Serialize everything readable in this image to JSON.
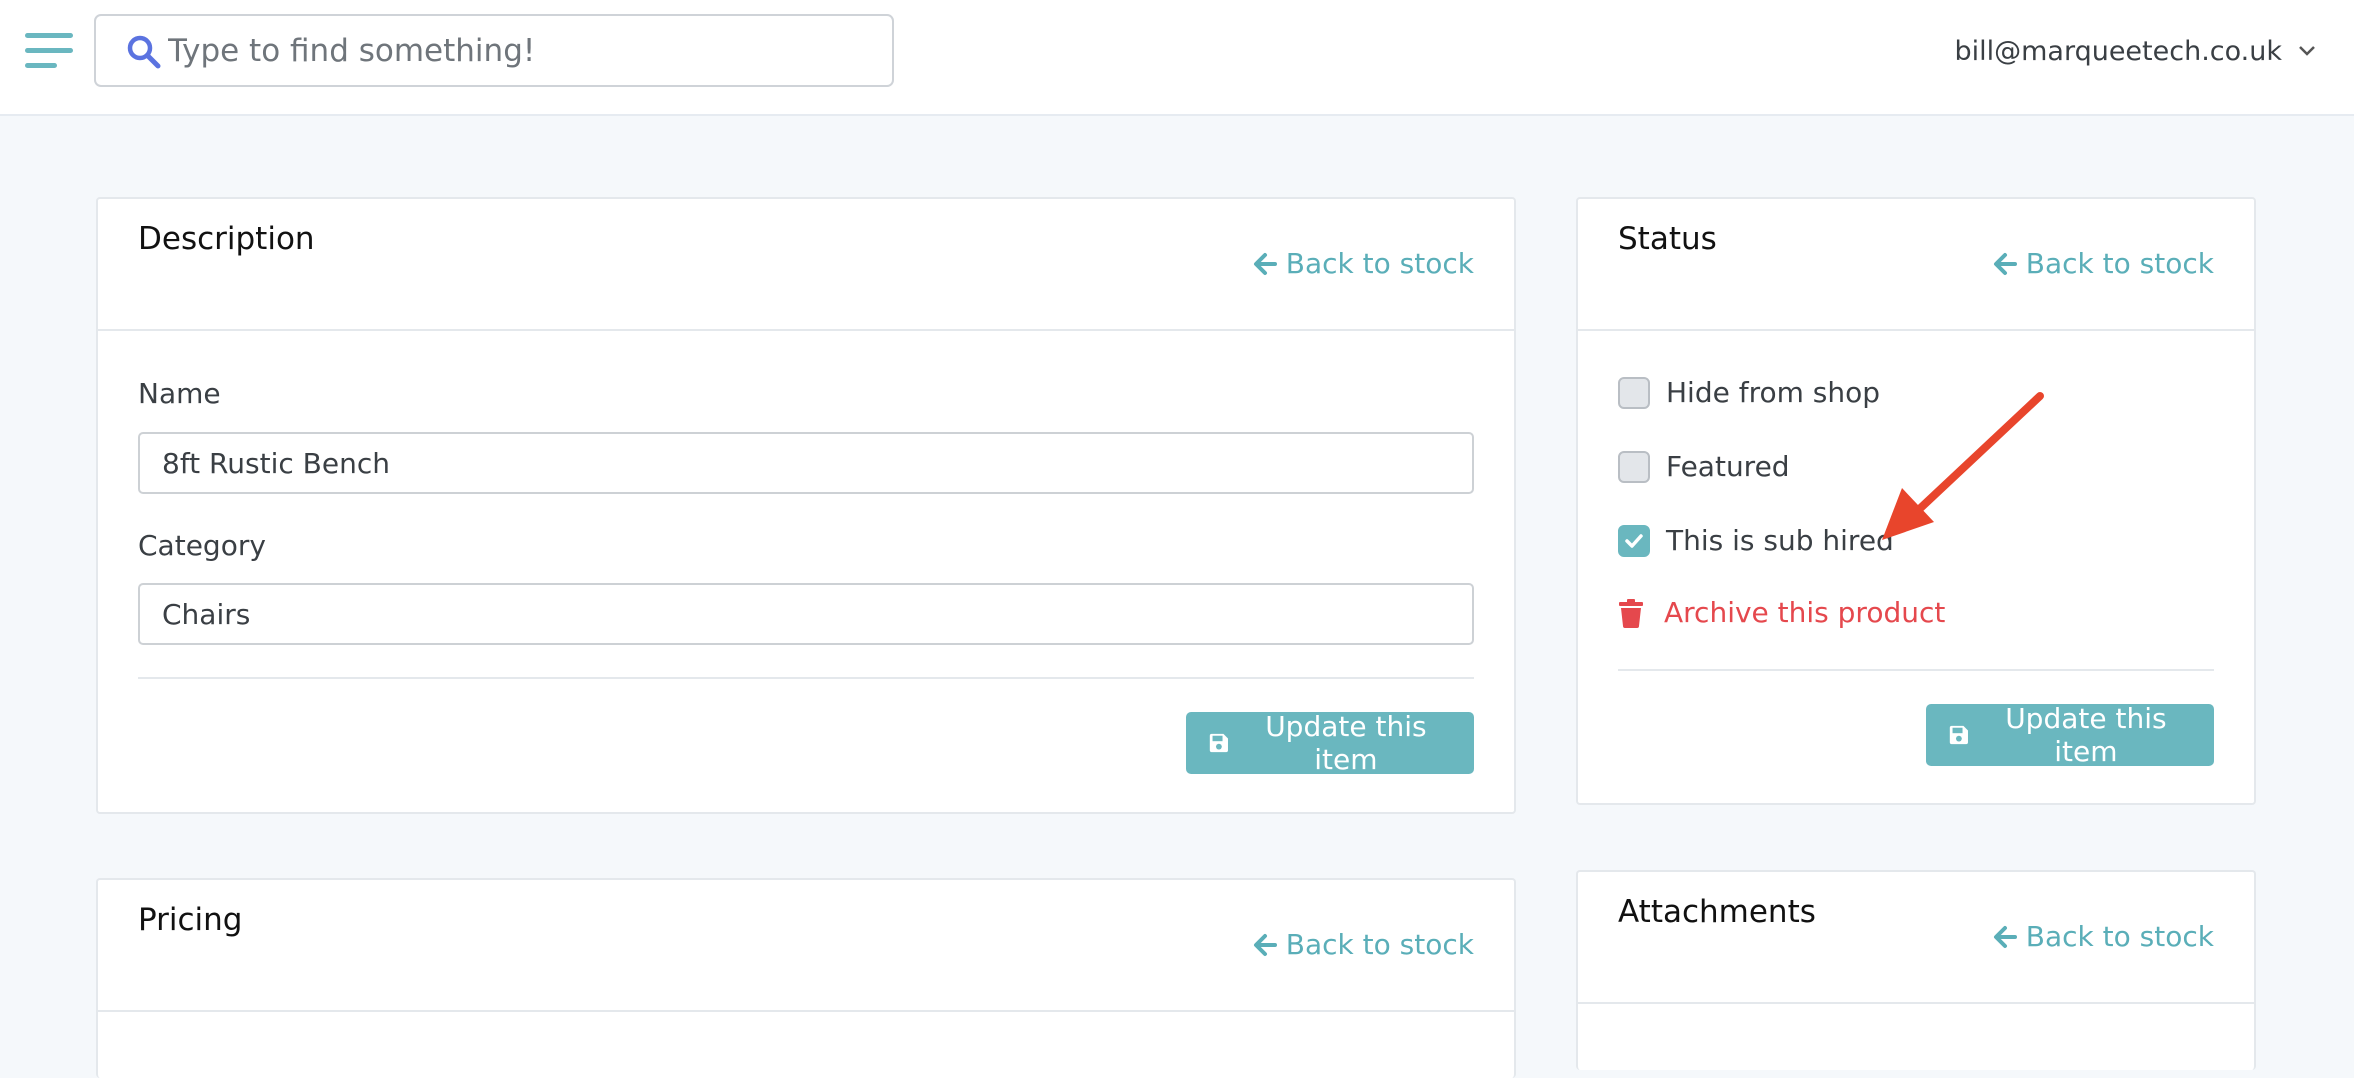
{
  "topbar": {
    "search_placeholder": "Type to find something!",
    "user_email": "bill@marqueetech.co.uk"
  },
  "description_card": {
    "title": "Description",
    "back_link": "Back to stock",
    "name_label": "Name",
    "name_value": "8ft Rustic Bench",
    "category_label": "Category",
    "category_value": "Chairs",
    "update_button": "Update this item"
  },
  "status_card": {
    "title": "Status",
    "back_link": "Back to stock",
    "options": [
      {
        "label": "Hide from shop",
        "checked": false
      },
      {
        "label": "Featured",
        "checked": false
      },
      {
        "label": "This is sub hired",
        "checked": true
      }
    ],
    "archive_label": "Archive this product",
    "update_button": "Update this item"
  },
  "pricing_card": {
    "title": "Pricing",
    "back_link": "Back to stock"
  },
  "attachments_card": {
    "title": "Attachments",
    "back_link": "Back to stock"
  },
  "colors": {
    "accent": "#6ab7bf",
    "link": "#5aaeb8",
    "danger": "#e5484d",
    "annotation_arrow": "#e8452c"
  },
  "icons": {
    "menu": "hamburger-icon",
    "search": "search-icon",
    "dropdown": "chevron-down-icon",
    "back": "arrow-left-icon",
    "save": "floppy-disk-icon",
    "check": "checkmark-icon",
    "archive": "trash-icon",
    "annotation": "annotation-arrow"
  }
}
